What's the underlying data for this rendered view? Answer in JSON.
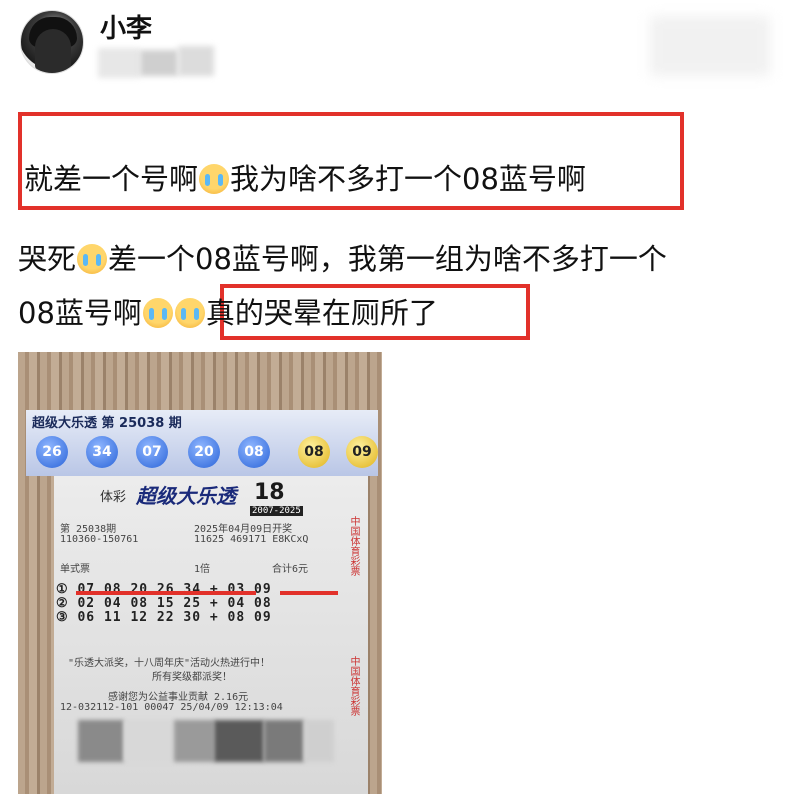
{
  "post": {
    "username": "小李",
    "line1_a": "就差一个号啊",
    "line1_b": "我为啥不多打一个08蓝号啊",
    "line2_a": "哭死",
    "line2_b": "差一个08蓝号啊，我第一组为啥不多打一个",
    "line3_a": "08蓝号啊",
    "line3_b": "真的哭晕在厕所了"
  },
  "ticket": {
    "banner_title": "超级大乐透  第 25038 期",
    "front_numbers": [
      "26",
      "34",
      "07",
      "20",
      "08"
    ],
    "back_numbers": [
      "08",
      "09"
    ],
    "brand": "体彩",
    "logo": "超级大乐透",
    "anniv": "18",
    "anniv_years": "2007-2025",
    "issue": "第 25038期",
    "date": "2025年04月09日开奖",
    "serial_left": "110360-150761",
    "serial_right": "11625 469171  E8KCxQ",
    "ticket_type": "单式票",
    "multiplier": "1倍",
    "total": "合计6元",
    "row1": "① 07 08 20 26 34  +  03 09",
    "row2": "② 02 04 08 15 25  +  04 08",
    "row3": "③ 06 11 12 22 30  +  08 09",
    "promo1": "\"乐透大派奖，十八周年庆\"活动火热进行中！",
    "promo2": "所有奖级都派奖！",
    "donation": "感谢您为公益事业贡献 2.16元",
    "footer": "12-032112-101  00047  25/04/09 12:13:04",
    "side_text": "中国体育彩票"
  },
  "colors": {
    "highlight_red": "#e2312a",
    "ball_blue": "#2a64d8",
    "ball_yellow": "#e0b21a"
  }
}
